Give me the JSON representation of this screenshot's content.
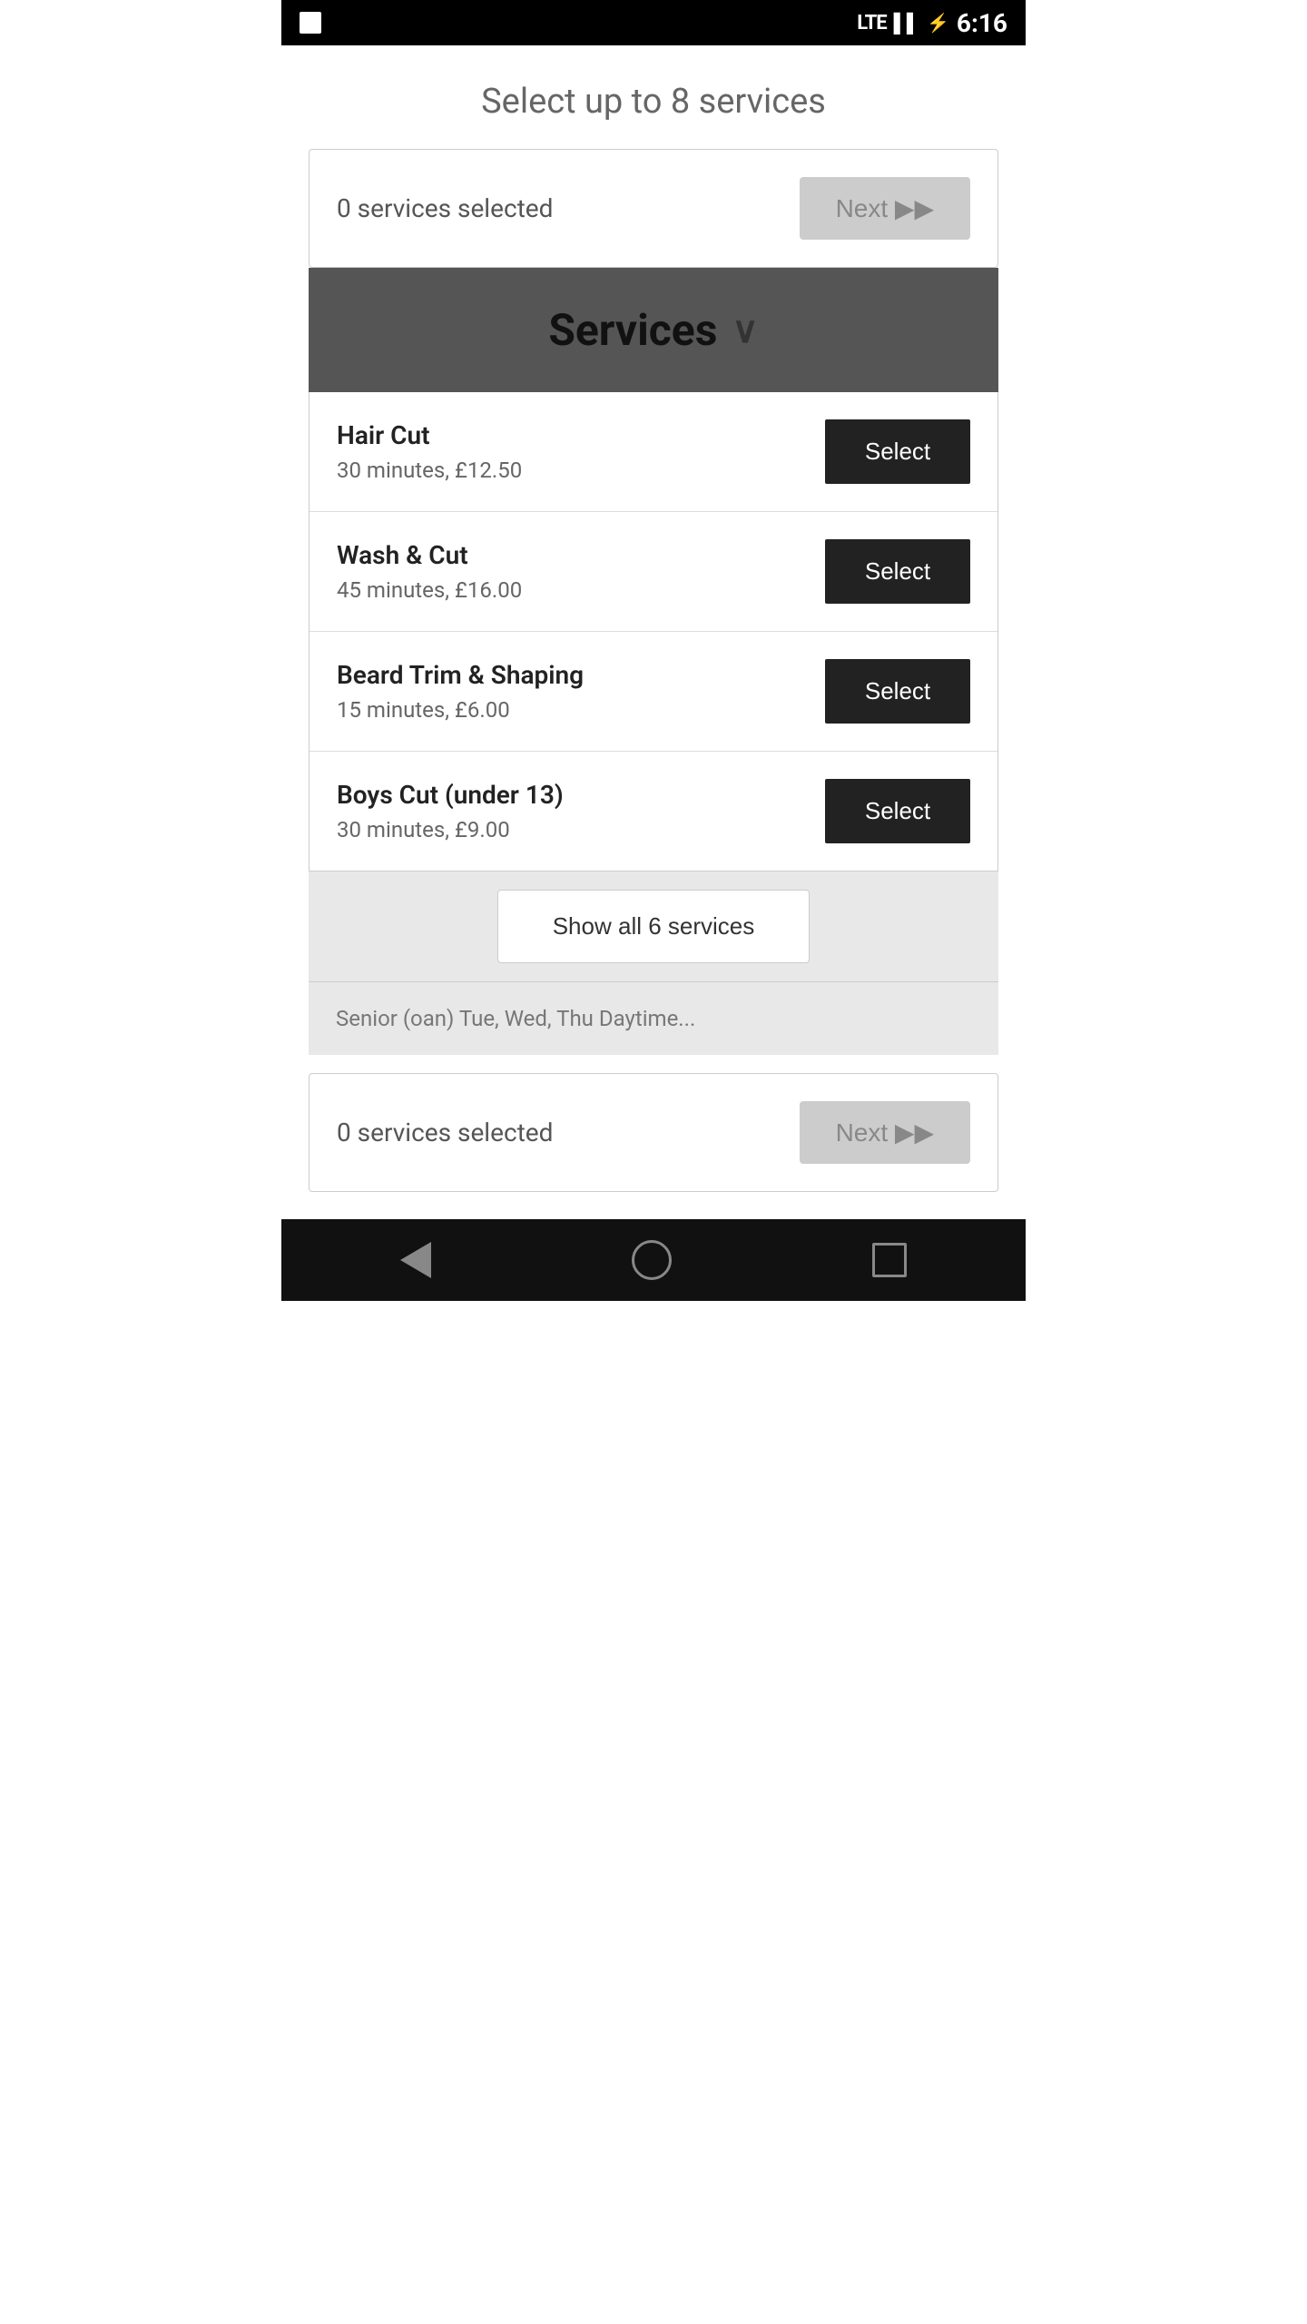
{
  "statusBar": {
    "time": "6:16",
    "lte": "LTE",
    "batteryIcon": "⚡"
  },
  "page": {
    "title": "Select up to 8 services"
  },
  "topBar": {
    "servicesSelectedText": "0 services selected",
    "nextLabel": "Next ▶▶"
  },
  "servicesHeader": {
    "label": "Services",
    "chevron": "∨"
  },
  "services": [
    {
      "name": "Hair Cut",
      "details": "30 minutes, £12.50",
      "selectLabel": "Select"
    },
    {
      "name": "Wash & Cut",
      "details": "45 minutes, £16.00",
      "selectLabel": "Select"
    },
    {
      "name": "Beard Trim & Shaping",
      "details": "15 minutes, £6.00",
      "selectLabel": "Select"
    },
    {
      "name": "Boys Cut (under 13)",
      "details": "30 minutes, £9.00",
      "selectLabel": "Select"
    }
  ],
  "showAllBtn": {
    "label": "Show all 6 services"
  },
  "partialService": {
    "name": "Senior (oan) Tue, Wed, Thu Daytime..."
  },
  "bottomBar": {
    "servicesSelectedText": "0 services selected",
    "nextLabel": "Next ▶▶"
  },
  "nav": {
    "backLabel": "back",
    "homeLabel": "home",
    "recentLabel": "recent"
  }
}
